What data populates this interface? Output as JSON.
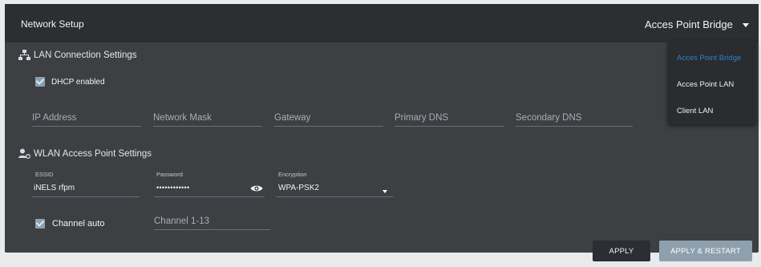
{
  "header": {
    "title": "Network Setup",
    "mode_value": "Acces Point Bridge"
  },
  "mode_menu": {
    "items": [
      "Acces Point Bridge",
      "Acces Point LAN",
      "Client LAN"
    ],
    "selected": "Acces Point Bridge"
  },
  "lan": {
    "title": "LAN Connection Settings",
    "dhcp_label": "DHCP enabled",
    "dhcp_checked": true,
    "fields": [
      {
        "placeholder": "IP Address",
        "value": ""
      },
      {
        "placeholder": "Network Mask",
        "value": ""
      },
      {
        "placeholder": "Gateway",
        "value": ""
      },
      {
        "placeholder": "Primary DNS",
        "value": ""
      },
      {
        "placeholder": "Secondary DNS",
        "value": ""
      }
    ]
  },
  "wlan": {
    "title": "WLAN Access Point Settings",
    "essid_label": "ESSID",
    "essid_value": "iNELS rfpm",
    "password_label": "Password",
    "password_value": "••••••••••••",
    "encryption_label": "Encryption",
    "encryption_value": "WPA-PSK2",
    "channel_auto_label": "Channel auto",
    "channel_auto_checked": true,
    "channel_placeholder": "Channel 1-13"
  },
  "buttons": {
    "apply": "APPLY",
    "apply_restart": "APPLY & RESTART"
  },
  "colors": {
    "panel_bg": "#3d3f43",
    "header_bg": "#2c2e31",
    "accent": "#2f7fd4",
    "checkbox": "#8ba1b3",
    "restart_button": "#8ea0ad"
  }
}
